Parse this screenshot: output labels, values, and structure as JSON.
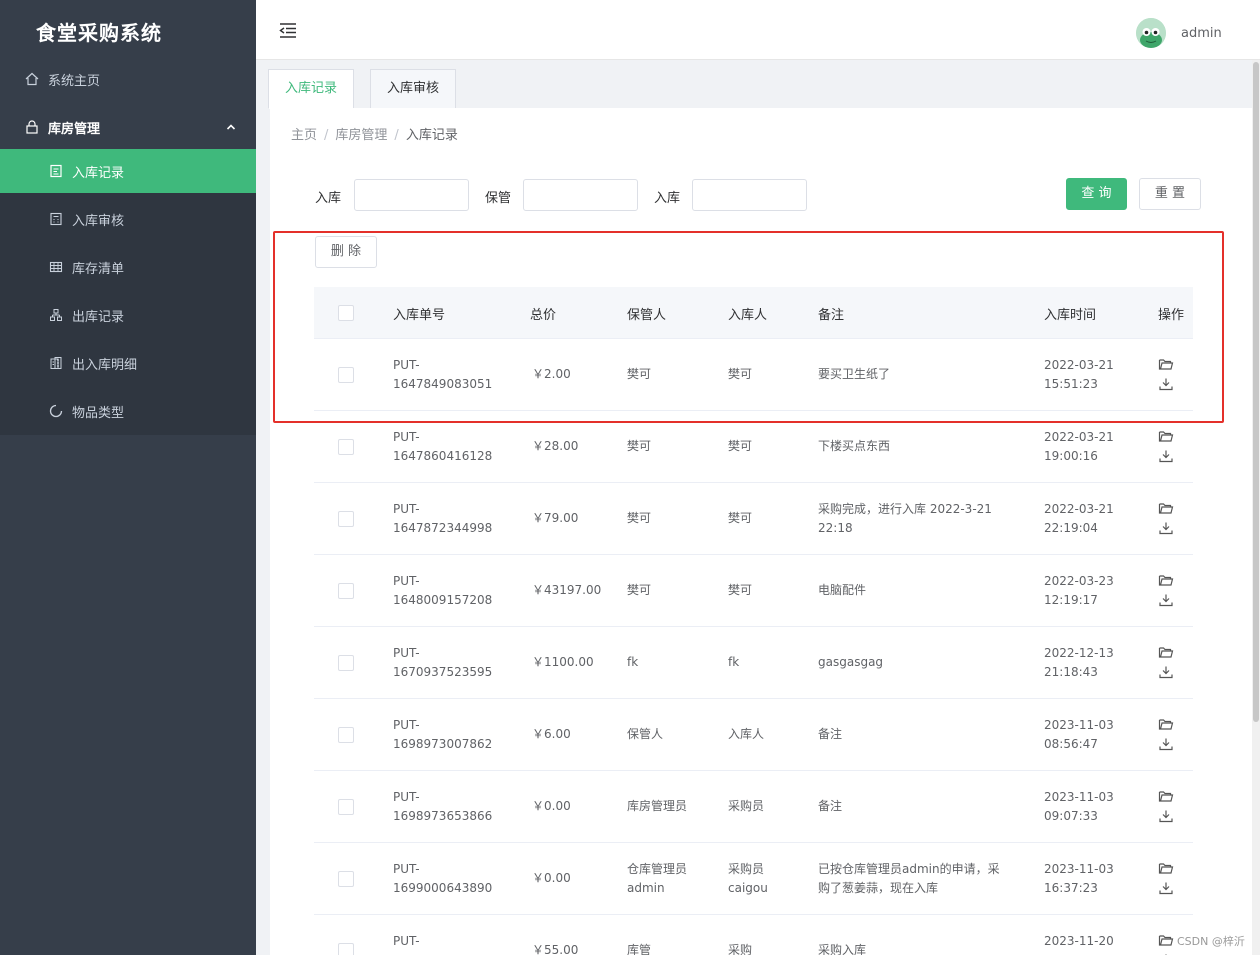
{
  "sidebar": {
    "brand": "食堂采购系统",
    "items": [
      {
        "label": "系统主页",
        "icon": "home-icon"
      },
      {
        "label": "库房管理",
        "icon": "lock-icon"
      },
      {
        "label": "入库记录",
        "icon": "document-icon",
        "active": true
      },
      {
        "label": "入库审核",
        "icon": "calculator-icon"
      },
      {
        "label": "库存清单",
        "icon": "grid-icon"
      },
      {
        "label": "出库记录",
        "icon": "organization-icon"
      },
      {
        "label": "出入库明细",
        "icon": "building-icon"
      },
      {
        "label": "物品类型",
        "icon": "loading-icon"
      }
    ]
  },
  "header": {
    "username": "admin"
  },
  "tabs": [
    "入库记录",
    "入库审核"
  ],
  "breadcrumb": [
    "主页",
    "库房管理",
    "入库记录"
  ],
  "search": {
    "fields": [
      {
        "label": "入库",
        "value": ""
      },
      {
        "label": "保管",
        "value": ""
      },
      {
        "label": "入库",
        "value": ""
      }
    ],
    "query_label": "查 询",
    "reset_label": "重 置"
  },
  "toolbar": {
    "delete_label": "删 除"
  },
  "table": {
    "columns": [
      "入库单号",
      "总价",
      "保管人",
      "入库人",
      "备注",
      "入库时间",
      "操作"
    ],
    "rows": [
      {
        "id": [
          "PUT-",
          "1647849083051"
        ],
        "price": "￥2.00",
        "keeper": [
          "樊可"
        ],
        "inputter": [
          "樊可"
        ],
        "note": [
          "要买卫生纸了"
        ],
        "time": [
          "2022-03-21",
          "15:51:23"
        ]
      },
      {
        "id": [
          "PUT-",
          "1647860416128"
        ],
        "price": "￥28.00",
        "keeper": [
          "樊可"
        ],
        "inputter": [
          "樊可"
        ],
        "note": [
          "下楼买点东西"
        ],
        "time": [
          "2022-03-21",
          "19:00:16"
        ]
      },
      {
        "id": [
          "PUT-",
          "1647872344998"
        ],
        "price": "￥79.00",
        "keeper": [
          "樊可"
        ],
        "inputter": [
          "樊可"
        ],
        "note": [
          "采购完成，进行入库 2022-3-21",
          "22:18"
        ],
        "time": [
          "2022-03-21",
          "22:19:04"
        ]
      },
      {
        "id": [
          "PUT-",
          "1648009157208"
        ],
        "price": "￥43197.00",
        "keeper": [
          "樊可"
        ],
        "inputter": [
          "樊可"
        ],
        "note": [
          "电脑配件"
        ],
        "time": [
          "2022-03-23",
          "12:19:17"
        ]
      },
      {
        "id": [
          "PUT-",
          "1670937523595"
        ],
        "price": "￥1100.00",
        "keeper": [
          "fk"
        ],
        "inputter": [
          "fk"
        ],
        "note": [
          "gasgasgag"
        ],
        "time": [
          "2022-12-13",
          "21:18:43"
        ]
      },
      {
        "id": [
          "PUT-",
          "1698973007862"
        ],
        "price": "￥6.00",
        "keeper": [
          "保管人"
        ],
        "inputter": [
          "入库人"
        ],
        "note": [
          "备注"
        ],
        "time": [
          "2023-11-03",
          "08:56:47"
        ]
      },
      {
        "id": [
          "PUT-",
          "1698973653866"
        ],
        "price": "￥0.00",
        "keeper": [
          "库房管理员"
        ],
        "inputter": [
          "采购员"
        ],
        "note": [
          "备注"
        ],
        "time": [
          "2023-11-03",
          "09:07:33"
        ]
      },
      {
        "id": [
          "PUT-",
          "1699000643890"
        ],
        "price": "￥0.00",
        "keeper": [
          "仓库管理员",
          "admin"
        ],
        "inputter": [
          "采购员",
          "caigou"
        ],
        "note": [
          "已按仓库管理员admin的申请，采",
          "购了葱姜蒜，现在入库"
        ],
        "time": [
          "2023-11-03",
          "16:37:23"
        ]
      },
      {
        "id": [
          "PUT-",
          ""
        ],
        "price": "￥55.00",
        "keeper": [
          "库管"
        ],
        "inputter": [
          "采购"
        ],
        "note": [
          "采购入库"
        ],
        "time": [
          "2023-11-20",
          ""
        ]
      }
    ]
  },
  "watermark": "CSDN @梓沂",
  "colors": {
    "sidebar_bg": "#363e4a",
    "accent": "#3fb97c",
    "highlight": "#e4302a"
  }
}
